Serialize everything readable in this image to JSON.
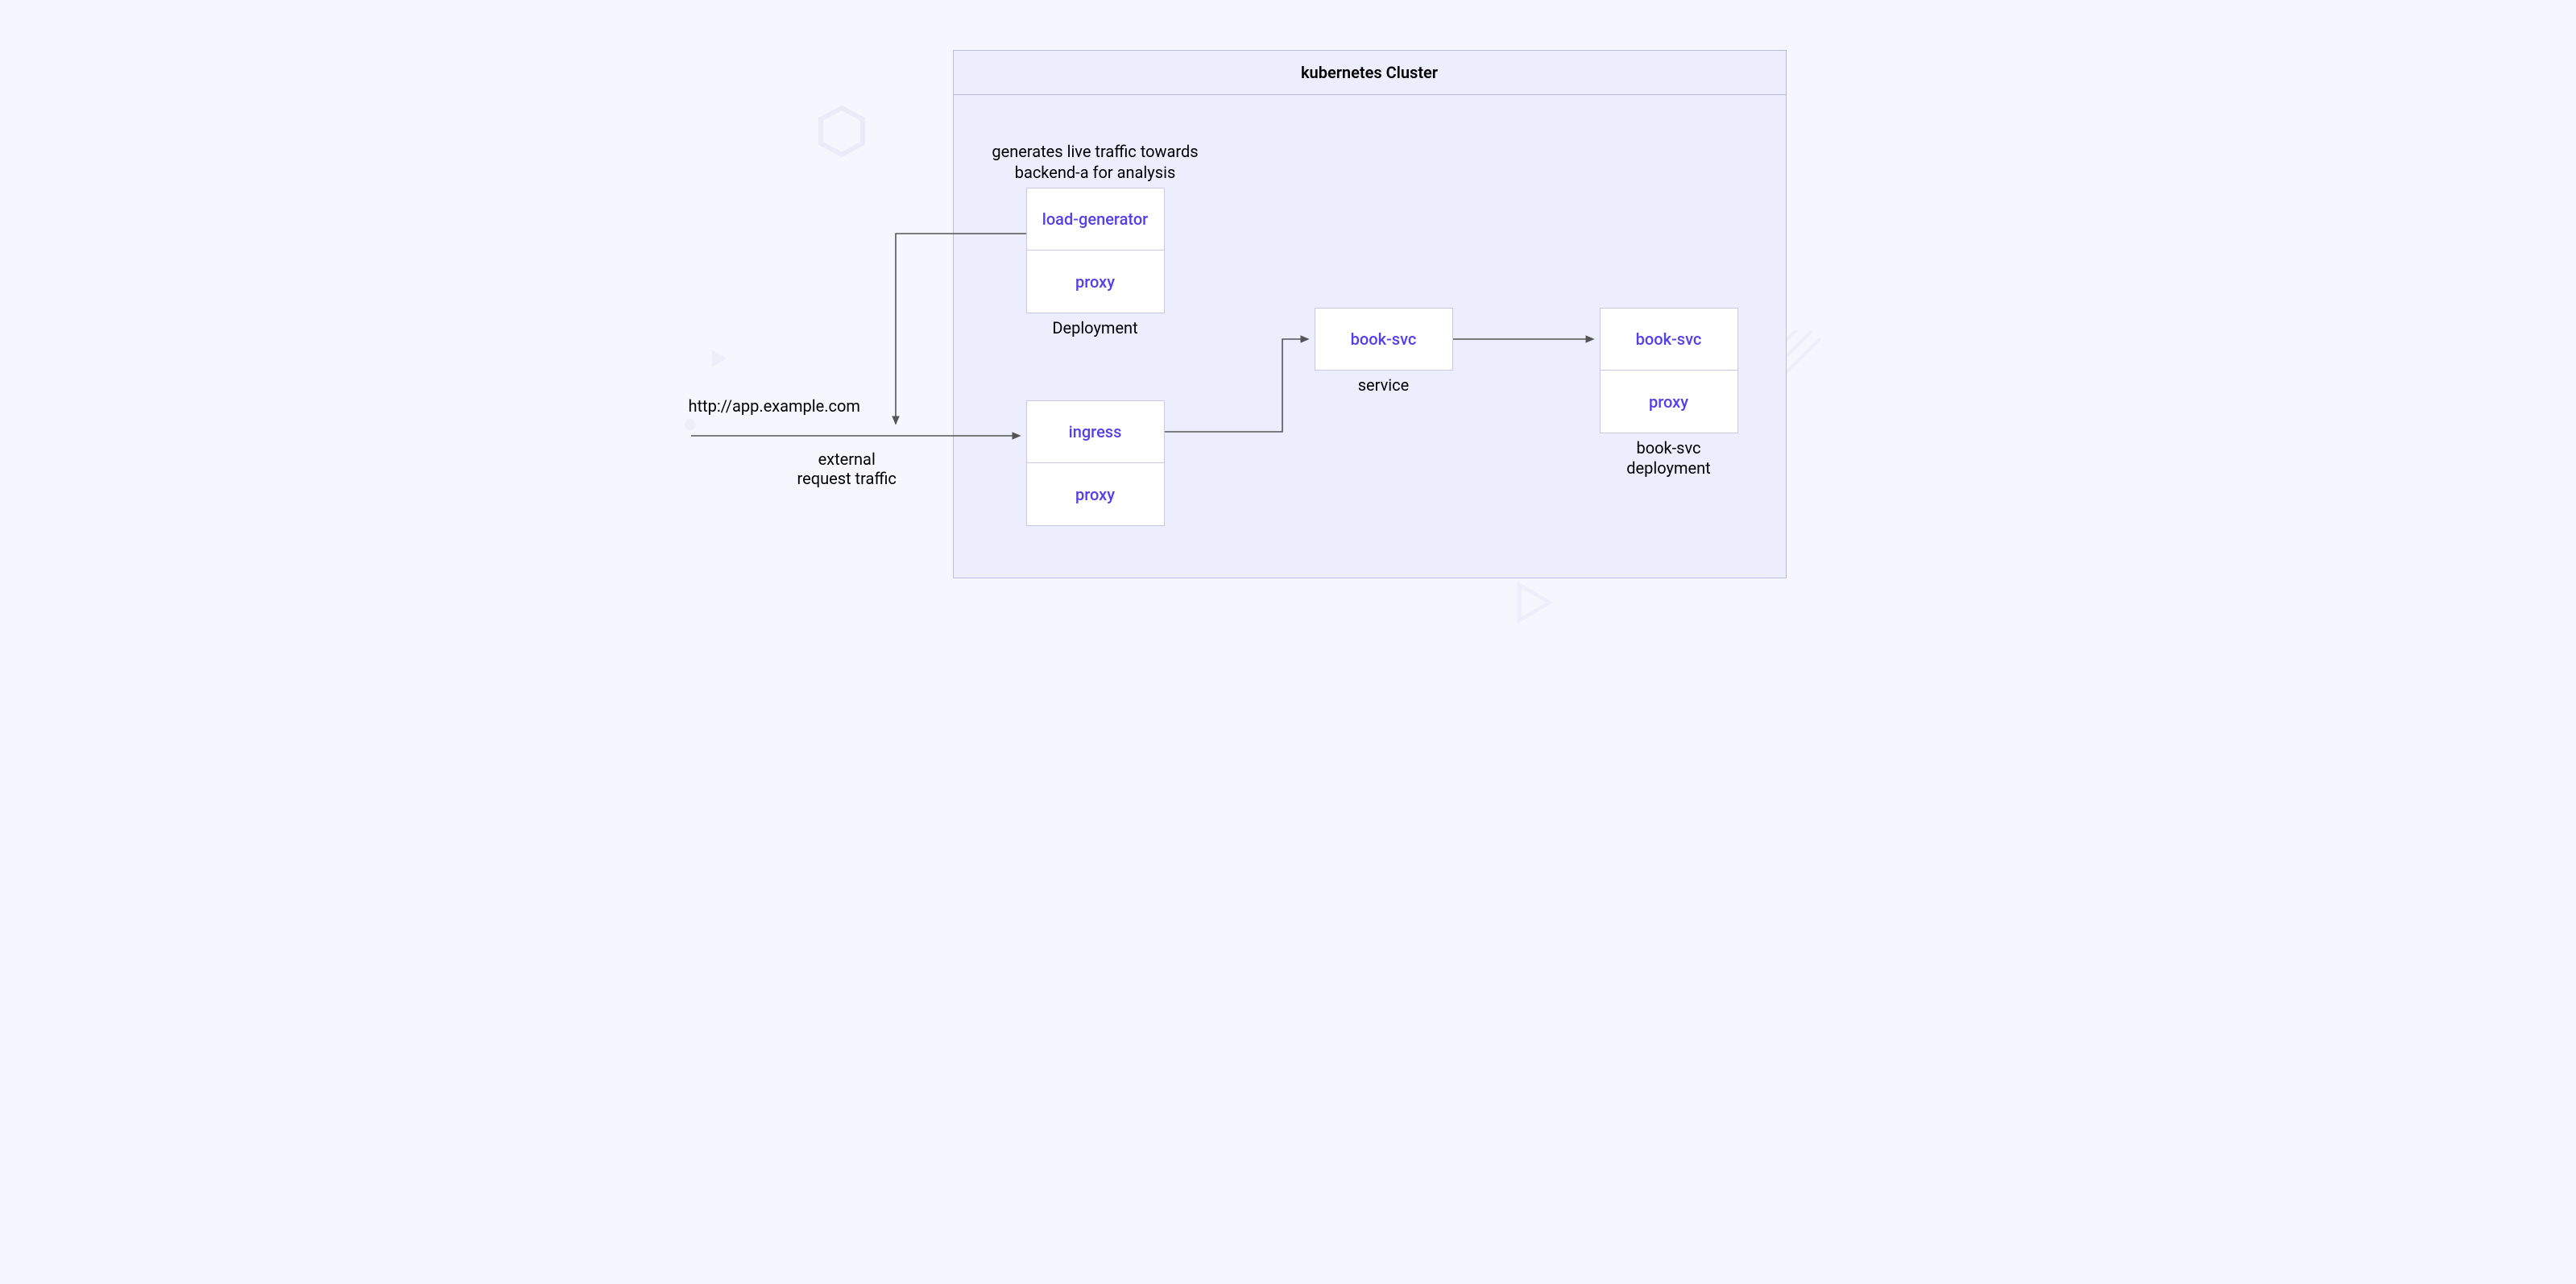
{
  "cluster": {
    "title": "kubernetes Cluster"
  },
  "loadgen": {
    "annotation_line1": "generates live traffic towards",
    "annotation_line2": "backend-a for analysis",
    "cell1": "load-generator",
    "cell2": "proxy",
    "caption": "Deployment"
  },
  "ingress": {
    "cell1": "ingress",
    "cell2": "proxy"
  },
  "service": {
    "cell1": "book-svc",
    "caption": "service"
  },
  "booksvc": {
    "cell1": "book-svc",
    "cell2": "proxy",
    "caption_line1": "book-svc",
    "caption_line2": "deployment"
  },
  "external": {
    "url": "http://app.example.com",
    "label_line1": "external",
    "label_line2": "request traffic"
  }
}
